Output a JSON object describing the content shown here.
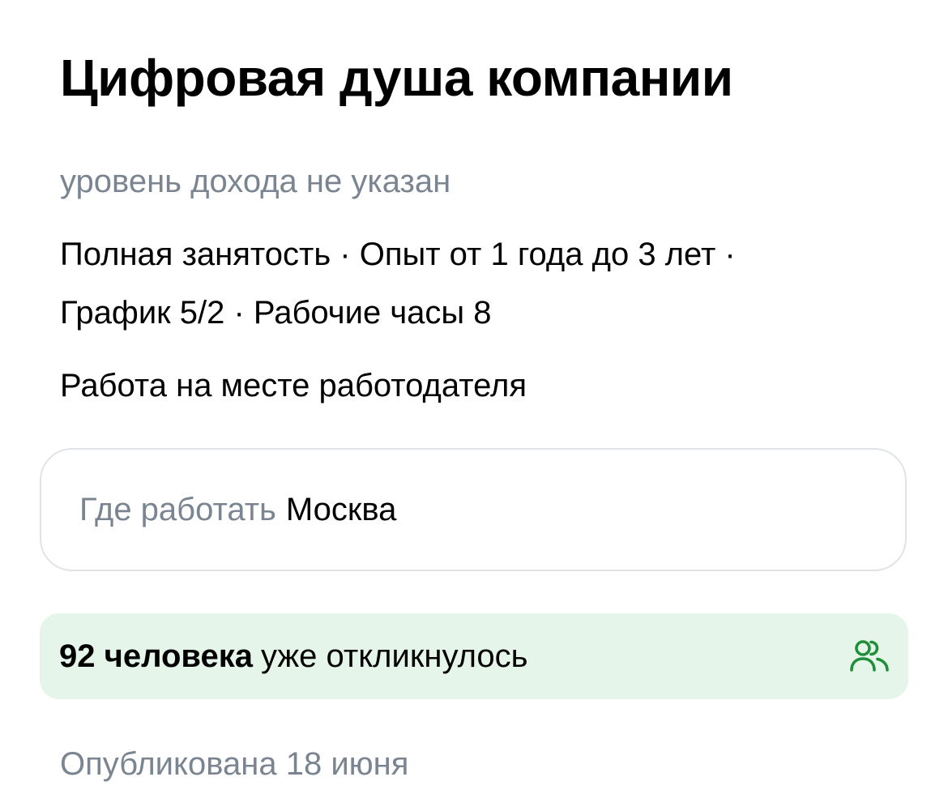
{
  "job": {
    "title": "Цифровая душа компании",
    "salary": "уровень дохода не указан",
    "details_line1": "Полная занятость · Опыт от 1 года до 3 лет ·",
    "details_line2": "График 5/2 · Рабочие часы 8",
    "workplace": "Работа на месте работодателя"
  },
  "location": {
    "label": "Где работать",
    "value": "Москва"
  },
  "responses": {
    "count": "92 человека",
    "text": "уже откликнулось",
    "icon": "users-icon",
    "background_color": "#e6f5e9",
    "icon_color": "#1f8f3a"
  },
  "published": {
    "text": "Опубликована 18 июня"
  },
  "colors": {
    "muted_text": "#7a8591",
    "primary_text": "#000000",
    "card_border": "#dfe3e8"
  }
}
